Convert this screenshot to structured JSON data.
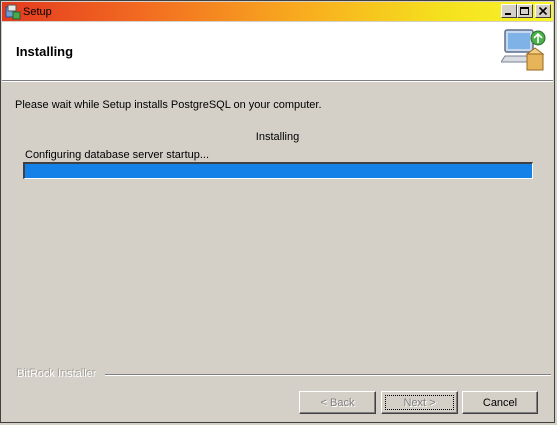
{
  "window": {
    "title": "Setup",
    "icon": "setup-app-icon",
    "controls": {
      "minimize": "_",
      "maximize": "□",
      "close": "✕"
    }
  },
  "header": {
    "title": "Installing",
    "icon": "computer-install-icon"
  },
  "main": {
    "message": "Please wait while Setup installs PostgreSQL on your computer.",
    "progress_title": "Installing",
    "status_text": "Configuring database server startup...",
    "progress_fraction": 1.0,
    "progress_color": "#1381e8"
  },
  "footer": {
    "brand": "BitRock Installer",
    "back_label": "< Back",
    "next_label": "Next >",
    "cancel_label": "Cancel"
  },
  "colors": {
    "title_gradient_start": "#e33a1f",
    "title_gradient_end": "#f8f52a",
    "window_bg": "#d4d0c8",
    "header_bg": "#ffffff"
  }
}
